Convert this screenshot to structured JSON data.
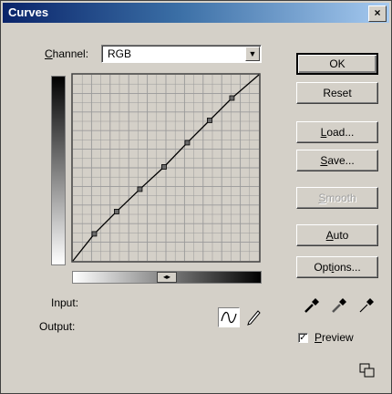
{
  "window": {
    "title": "Curves",
    "close_glyph": "×"
  },
  "channel": {
    "label_prefix": "",
    "label_hotkey": "C",
    "label_rest": "hannel:",
    "value": "RGB"
  },
  "graph": {
    "grid_divisions": 10,
    "curve_points": [
      [
        0,
        0
      ],
      [
        0.115,
        0.145
      ],
      [
        0.235,
        0.265
      ],
      [
        0.36,
        0.385
      ],
      [
        0.49,
        0.505
      ],
      [
        0.615,
        0.635
      ],
      [
        0.735,
        0.755
      ],
      [
        0.855,
        0.875
      ],
      [
        1,
        1
      ]
    ],
    "colors": {
      "grid": "#9a9a9a",
      "curve": "#000000",
      "background": "#d4d0c8"
    }
  },
  "gradient_toggle_glyph": "◂▸",
  "readouts": {
    "input_label": "Input:",
    "output_label": "Output:"
  },
  "buttons": {
    "ok": "OK",
    "reset": "Reset",
    "load_hotkey": "L",
    "load_rest": "oad...",
    "save_hotkey": "S",
    "save_rest": "ave...",
    "smooth_hotkey": "S",
    "smooth_rest": "mooth",
    "auto_hotkey": "A",
    "auto_rest": "uto",
    "options_pre": "Opt",
    "options_hotkey": "i",
    "options_rest": "ons..."
  },
  "eyedroppers": [
    "black-eyedropper-icon",
    "gray-eyedropper-icon",
    "white-eyedropper-icon"
  ],
  "preview": {
    "checked": true,
    "check_glyph": "✓",
    "label_hotkey": "P",
    "label_rest": "review"
  },
  "curve_tools": [
    "curve-point-tool-icon",
    "pencil-tool-icon"
  ],
  "resize_icon": "expand-view-icon"
}
